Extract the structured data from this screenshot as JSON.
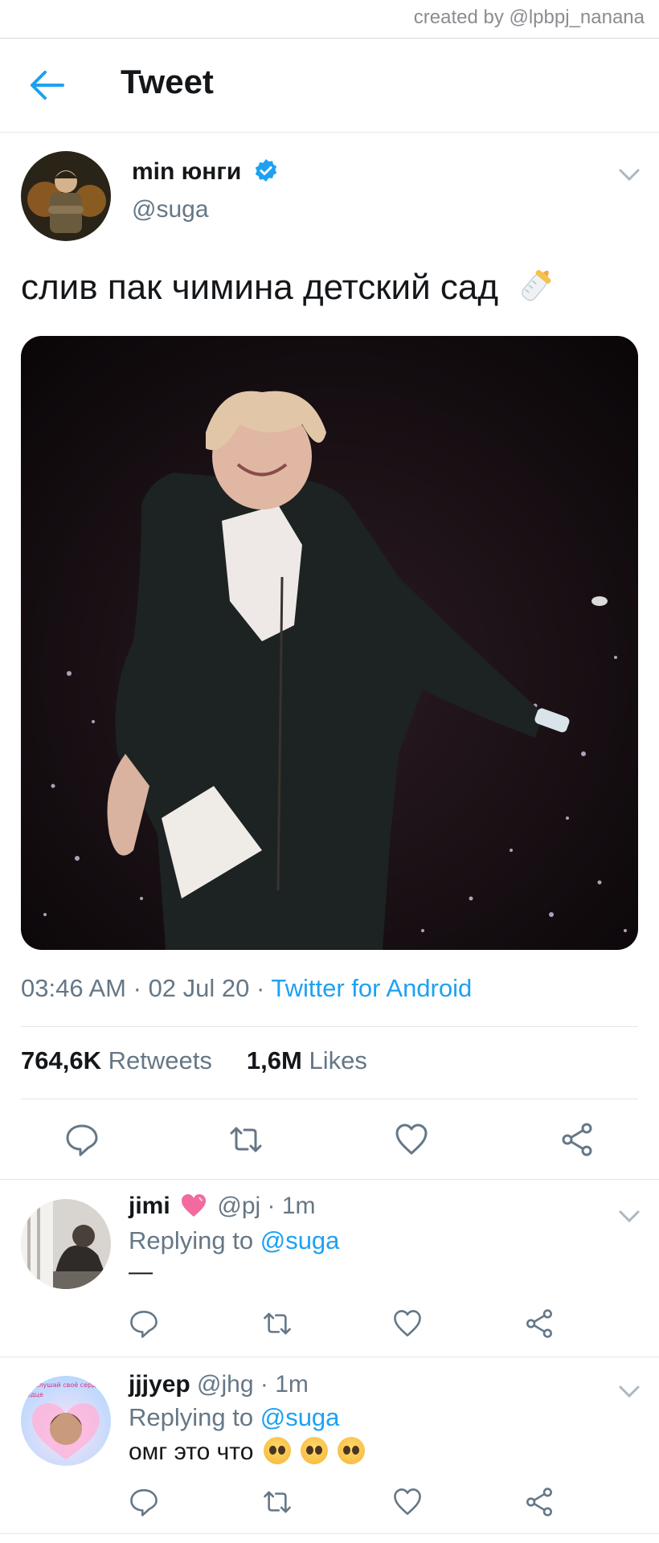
{
  "watermark": "created by @lpbpj_nanana",
  "header": {
    "title": "Tweet"
  },
  "tweet": {
    "name": "min юнги",
    "handle": "@suga",
    "text": "слив пак чимина детский сад",
    "time": "03:46 AM",
    "date": "02 Jul 20",
    "sep": "·",
    "source": "Twitter for Android",
    "retweets_count": "764,6K",
    "retweets_label": "Retweets",
    "likes_count": "1,6M",
    "likes_label": "Likes"
  },
  "replies": [
    {
      "name": "jimi",
      "meta": "@pj · 1m",
      "replying_label": "Replying to",
      "replying_to": "@suga",
      "text": "—"
    },
    {
      "name": "jjjyep",
      "meta": "@jhg · 1m",
      "replying_label": "Replying to",
      "replying_to": "@suga",
      "text": "омг это что",
      "avatar_text_1": "слушай своё сердце",
      "avatar_text_2": "ердце"
    }
  ],
  "icons": [
    "back-arrow-icon",
    "chevron-down-icon",
    "verified-badge-icon",
    "baby-bottle-icon",
    "reply-icon",
    "retweet-icon",
    "like-icon",
    "share-icon",
    "pleading-face-icon"
  ],
  "colors": {
    "accent": "#1da1f2",
    "text": "#14171a",
    "muted": "#657786",
    "divider": "#e1e8ed",
    "like_pink": "#e0245e"
  }
}
